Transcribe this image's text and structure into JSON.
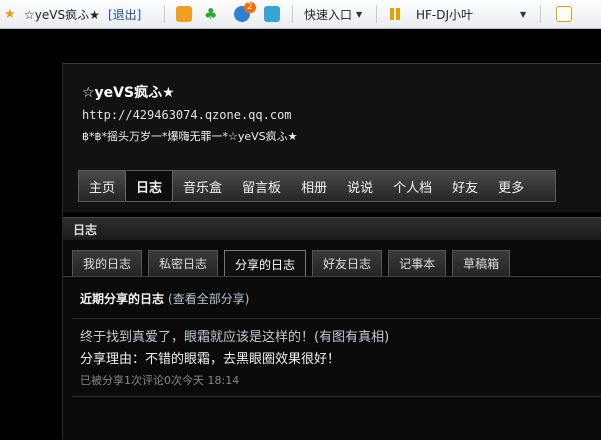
{
  "toolbar": {
    "site_title": "☆yeVS疯ふ★",
    "logout": "[退出]",
    "quick_entry": "快速入口",
    "music_user": "HF-DJ小叶",
    "badge_count": "2"
  },
  "profile": {
    "nickname": "☆yeVS疯ふ★",
    "url": "http://429463074.qzone.qq.com",
    "motto": "฿*฿*摇头万岁一*爆嗨无罪一*☆yeVS疯ふ★"
  },
  "nav": {
    "items": [
      {
        "label": "主页"
      },
      {
        "label": "日志",
        "active": true
      },
      {
        "label": "音乐盒"
      },
      {
        "label": "留言板"
      },
      {
        "label": "相册"
      },
      {
        "label": "说说"
      },
      {
        "label": "个人档"
      },
      {
        "label": "好友"
      },
      {
        "label": "更多"
      }
    ]
  },
  "rizhi": {
    "title": "日志",
    "tabs": [
      "我的日志",
      "私密日志",
      "分享的日志",
      "好友日志",
      "记事本",
      "草稿箱"
    ],
    "active_tab": "分享的日志",
    "recent_label": "近期分享的日志",
    "view_all": "(查看全部分享)",
    "post": {
      "title": "终于找到真爱了，眼霜就应该是这样的！(有图有真相)",
      "reason": "分享理由：不错的眼霜，去黑眼圈效果很好！",
      "meta": "已被分享1次评论0次今天  18:14"
    }
  },
  "colors": {
    "background": "#000000",
    "link_blue": "#1c4fa0",
    "post_title": "#c2cad6"
  }
}
